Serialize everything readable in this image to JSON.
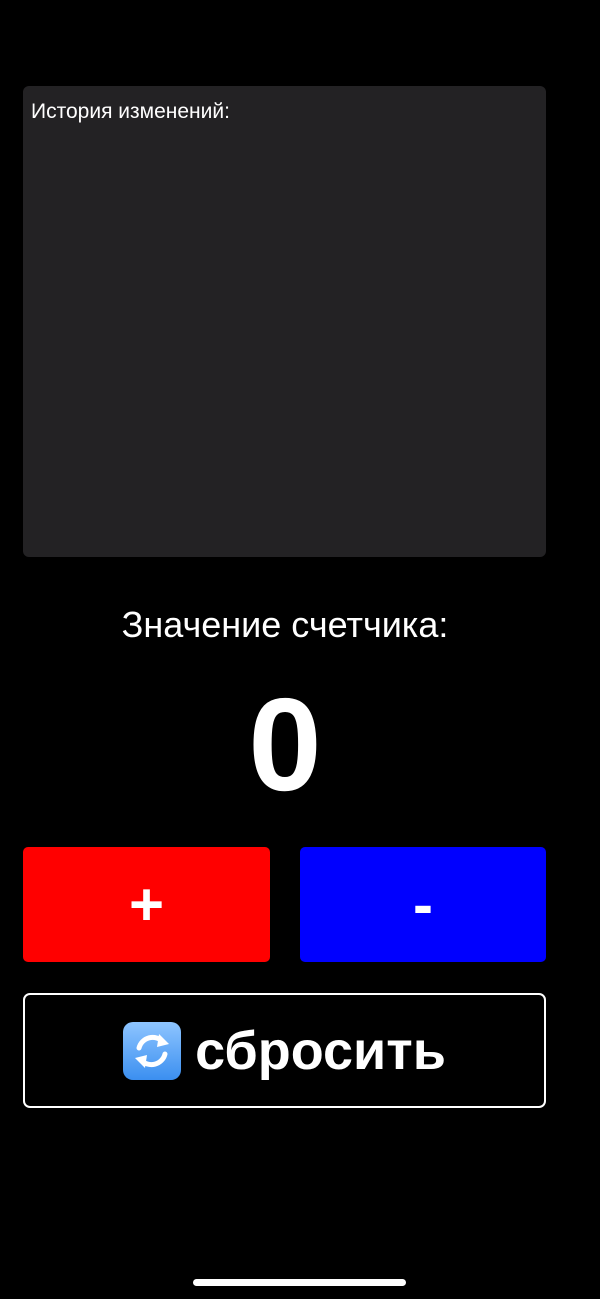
{
  "history": {
    "title": "История изменений:"
  },
  "counter": {
    "label": "Значение счетчика:",
    "value": "0"
  },
  "buttons": {
    "increment_label": "+",
    "decrement_label": "-",
    "reset_label": "сбросить",
    "reset_icon": "arrows-counterclockwise-icon"
  },
  "colors": {
    "increment": "#ff0000",
    "decrement": "#0000ff",
    "panel": "#232224",
    "background": "#000000"
  }
}
